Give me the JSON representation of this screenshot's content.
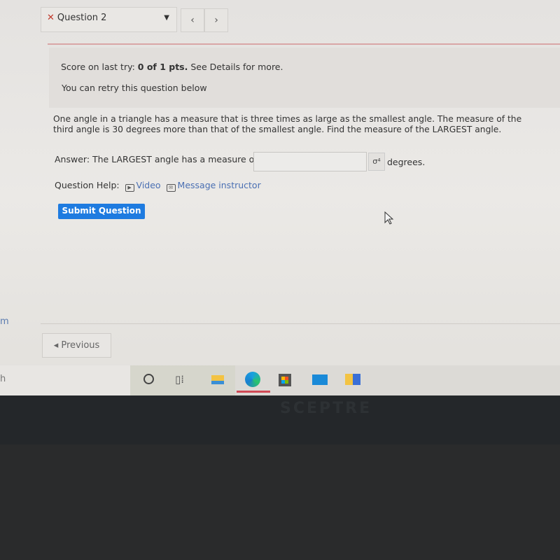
{
  "nav": {
    "question_label": "Question 2",
    "close_glyph": "✕",
    "prev_glyph": "‹",
    "next_glyph": "›"
  },
  "status": {
    "score_prefix": "Score on last try:",
    "score_value": "0 of 1 pts.",
    "score_suffix": "See Details for more.",
    "retry": "You can retry this question below"
  },
  "question": {
    "text": "One angle in a triangle has a measure that is three times as large as the smallest angle. The measure of the third angle is 30 degrees more than that of the smallest angle. Find the measure of the LARGEST angle."
  },
  "answer": {
    "label": "Answer: The LARGEST angle has a measure of",
    "value": "",
    "unit": "degrees.",
    "symbol_button": "σ⁴"
  },
  "help": {
    "label": "Question Help:",
    "video": "Video",
    "message": "Message instructor"
  },
  "submit_label": "Submit Question",
  "previous_label": "◂ Previous",
  "edge_fragments": [
    "m",
    "h"
  ],
  "taskbar": {
    "icons": [
      "cortana-icon",
      "task-view-icon",
      "file-explorer-icon",
      "edge-icon",
      "store-icon",
      "mail-icon",
      "app-icon"
    ]
  },
  "monitor_logo": "SCEPTRE",
  "colors": {
    "accent": "#1e7be0",
    "link": "#4a6fb3",
    "error": "#c0392b"
  }
}
